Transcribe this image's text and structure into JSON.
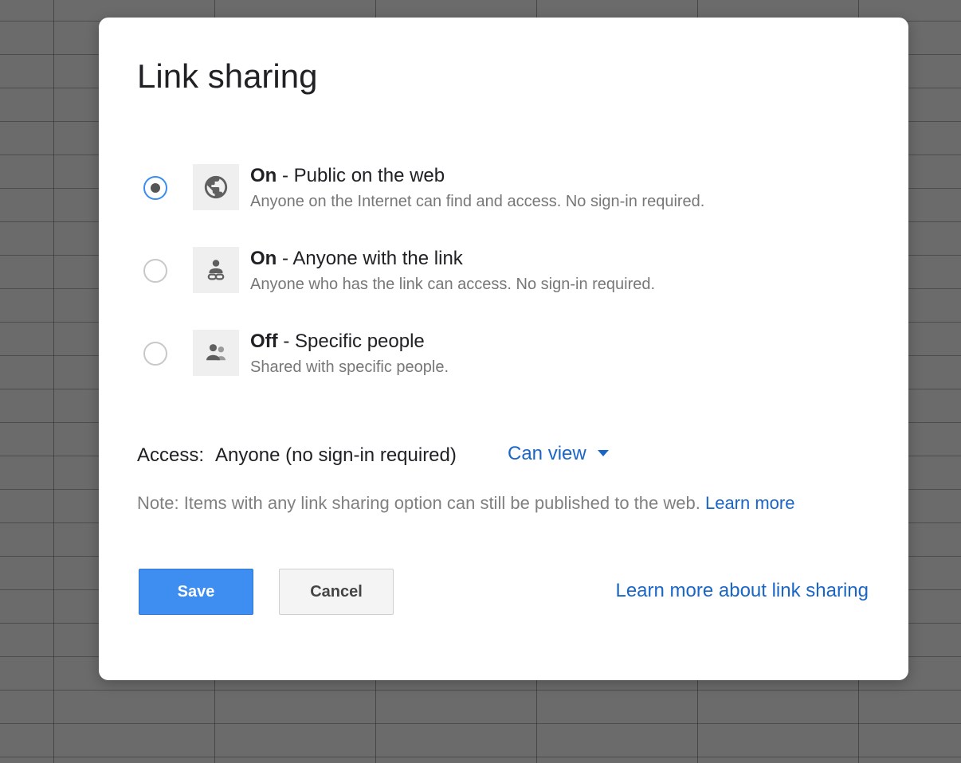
{
  "dialog": {
    "title": "Link sharing"
  },
  "options": [
    {
      "checked": true,
      "icon": "globe-icon",
      "label_bold": "On",
      "label_rest": " - Public on the web",
      "description": "Anyone on the Internet can find and access. No sign-in required."
    },
    {
      "checked": false,
      "icon": "person-link-icon",
      "label_bold": "On",
      "label_rest": " - Anyone with the link",
      "description": "Anyone who has the link can access. No sign-in required."
    },
    {
      "checked": false,
      "icon": "people-icon",
      "label_bold": "Off",
      "label_rest": " - Specific people",
      "description": "Shared with specific people."
    }
  ],
  "access": {
    "label": "Access:",
    "value": "Anyone (no sign-in required)",
    "permission": "Can view"
  },
  "note": {
    "text": "Note: Items with any link sharing option can still be published to the web.",
    "link": "Learn more"
  },
  "buttons": {
    "save": "Save",
    "cancel": "Cancel"
  },
  "footer_link": "Learn more about link sharing",
  "colors": {
    "accent_blue": "#3d8ef0",
    "link_blue": "#1a66c7",
    "overlay_gray": "#6b6b6b"
  }
}
